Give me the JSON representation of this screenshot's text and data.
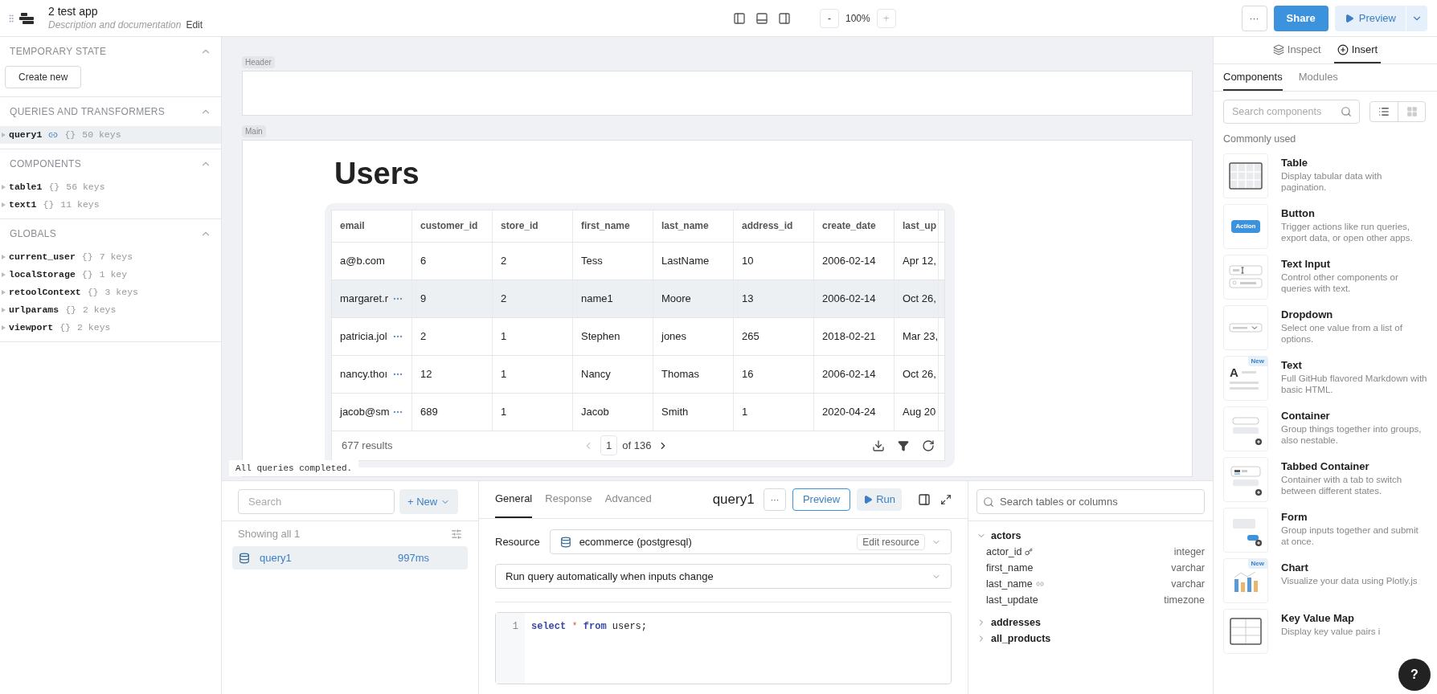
{
  "topbar": {
    "app_name": "2 test app",
    "description": "Description and documentation",
    "edit": "Edit",
    "zoom": {
      "minus": "-",
      "value": "100%",
      "plus": "+"
    },
    "more": "···",
    "share": "Share",
    "preview": "Preview"
  },
  "state_panel": {
    "sections": [
      {
        "title": "TEMPORARY STATE",
        "expanded": true,
        "button": "Create new"
      },
      {
        "title": "QUERIES AND TRANSFORMERS",
        "expanded": true,
        "items": [
          {
            "name": "query1",
            "linked": true,
            "braces": "{}",
            "count": "50 keys",
            "selected": true
          }
        ]
      },
      {
        "title": "COMPONENTS",
        "expanded": true,
        "items": [
          {
            "name": "table1",
            "linked": false,
            "braces": "{}",
            "count": "56 keys",
            "selected": false
          },
          {
            "name": "text1",
            "linked": false,
            "braces": "{}",
            "count": "11 keys",
            "selected": false
          }
        ]
      },
      {
        "title": "GLOBALS",
        "expanded": true,
        "items": [
          {
            "name": "current_user",
            "linked": false,
            "braces": "{}",
            "count": "7 keys",
            "selected": false
          },
          {
            "name": "localStorage",
            "linked": false,
            "braces": "{}",
            "count": "1 key",
            "selected": false
          },
          {
            "name": "retoolContext",
            "linked": false,
            "braces": "{}",
            "count": "3 keys",
            "selected": false
          },
          {
            "name": "urlparams",
            "linked": false,
            "braces": "{}",
            "count": "2 keys",
            "selected": false
          },
          {
            "name": "viewport",
            "linked": false,
            "braces": "{}",
            "count": "2 keys",
            "selected": false
          }
        ]
      }
    ]
  },
  "canvas": {
    "header_label": "Header",
    "main_label": "Main",
    "title": "Users",
    "status": "All queries completed.",
    "table": {
      "columns": [
        "email",
        "customer_id",
        "store_id",
        "first_name",
        "last_name",
        "address_id",
        "create_date",
        "last_up"
      ],
      "rows": [
        {
          "selected": false,
          "menu": false,
          "cells": [
            "a@b.com",
            "6",
            "2",
            "Tess",
            "LastName",
            "10",
            "2006-02-14",
            "Apr 12,"
          ]
        },
        {
          "selected": true,
          "menu": true,
          "cells": [
            "margaret.r",
            "9",
            "2",
            "name1",
            "Moore",
            "13",
            "2006-02-14",
            "Oct 26,"
          ]
        },
        {
          "selected": false,
          "menu": true,
          "cells": [
            "patricia.jol",
            "2",
            "1",
            "Stephen",
            "jones",
            "265",
            "2018-02-21",
            "Mar 23,"
          ]
        },
        {
          "selected": false,
          "menu": true,
          "cells": [
            "nancy.thoı",
            "12",
            "1",
            "Nancy",
            "Thomas",
            "16",
            "2006-02-14",
            "Oct 26,"
          ]
        },
        {
          "selected": false,
          "menu": true,
          "cells": [
            "jacob@sm",
            "689",
            "1",
            "Jacob",
            "Smith",
            "1",
            "2020-04-24",
            "Aug 20"
          ]
        }
      ],
      "results": "677 results",
      "page": "1",
      "of_pages": "of 136"
    }
  },
  "query_list": {
    "search_placeholder": "Search",
    "new_button": "+ New",
    "showing": "Showing all 1",
    "items": [
      {
        "name": "query1",
        "time": "997ms",
        "selected": true
      }
    ]
  },
  "editor": {
    "tabs": [
      {
        "label": "General",
        "selected": true
      },
      {
        "label": "Response",
        "selected": false
      },
      {
        "label": "Advanced",
        "selected": false
      }
    ],
    "title": "query1",
    "more": "···",
    "preview": "Preview",
    "run": "Run",
    "resource_label": "Resource",
    "resource": "ecommerce (postgresql)",
    "edit_resource": "Edit resource",
    "trigger": "Run query automatically when inputs change",
    "lines": [
      {
        "number": "1",
        "tokens": [
          {
            "text": "select",
            "kind": "keyword"
          },
          {
            "text": "*",
            "kind": "operator"
          },
          {
            "text": "from",
            "kind": "keyword"
          },
          {
            "text": "users;",
            "kind": "plain"
          }
        ]
      }
    ]
  },
  "schema": {
    "search_placeholder": "Search tables or columns",
    "tables": [
      {
        "name": "actors",
        "expanded": true,
        "columns": [
          {
            "name": "actor_id",
            "kind": "key",
            "type": "integer"
          },
          {
            "name": "first_name",
            "kind": "plain",
            "type": "varchar"
          },
          {
            "name": "last_name",
            "kind": "link",
            "type": "varchar"
          },
          {
            "name": "last_update",
            "kind": "plain",
            "type": "timezone"
          }
        ]
      },
      {
        "name": "addresses",
        "expanded": false
      },
      {
        "name": "all_products",
        "expanded": false
      }
    ]
  },
  "inspector": {
    "tabs": [
      {
        "label": "Inspect",
        "kind": "inspect",
        "selected": false
      },
      {
        "label": "Insert",
        "kind": "insert",
        "selected": true
      }
    ],
    "subtabs": [
      {
        "label": "Components",
        "selected": true
      },
      {
        "label": "Modules",
        "selected": false
      }
    ],
    "search_placeholder": "Search components",
    "view": [
      {
        "kind": "list",
        "selected": true
      },
      {
        "kind": "grid",
        "selected": false
      }
    ],
    "section": "Commonly used",
    "components": [
      {
        "kind": "table",
        "name": "Table",
        "description": "Display tabular data with pagination."
      },
      {
        "kind": "button",
        "name": "Button",
        "description": "Trigger actions like run queries, export data, or open other apps.",
        "preview_text": "Action"
      },
      {
        "kind": "text_input",
        "name": "Text Input",
        "description": "Control other components or queries with text."
      },
      {
        "kind": "dropdown",
        "name": "Dropdown",
        "description": "Select one value from a list of options."
      },
      {
        "kind": "text",
        "name": "Text",
        "description": "Full GitHub flavored Markdown with basic HTML.",
        "preview_text": "A",
        "badge": "New"
      },
      {
        "kind": "container",
        "name": "Container",
        "description": "Group things together into groups, also nestable."
      },
      {
        "kind": "tabbed",
        "name": "Tabbed Container",
        "description": "Container with a tab to switch between different states."
      },
      {
        "kind": "form",
        "name": "Form",
        "description": "Group inputs together and submit at once."
      },
      {
        "kind": "chart",
        "name": "Chart",
        "description": "Visualize your data using Plotly.js",
        "badge": "New"
      },
      {
        "kind": "kvmap",
        "name": "Key Value Map",
        "description": "Display key value pairs i"
      }
    ]
  },
  "help": "?"
}
